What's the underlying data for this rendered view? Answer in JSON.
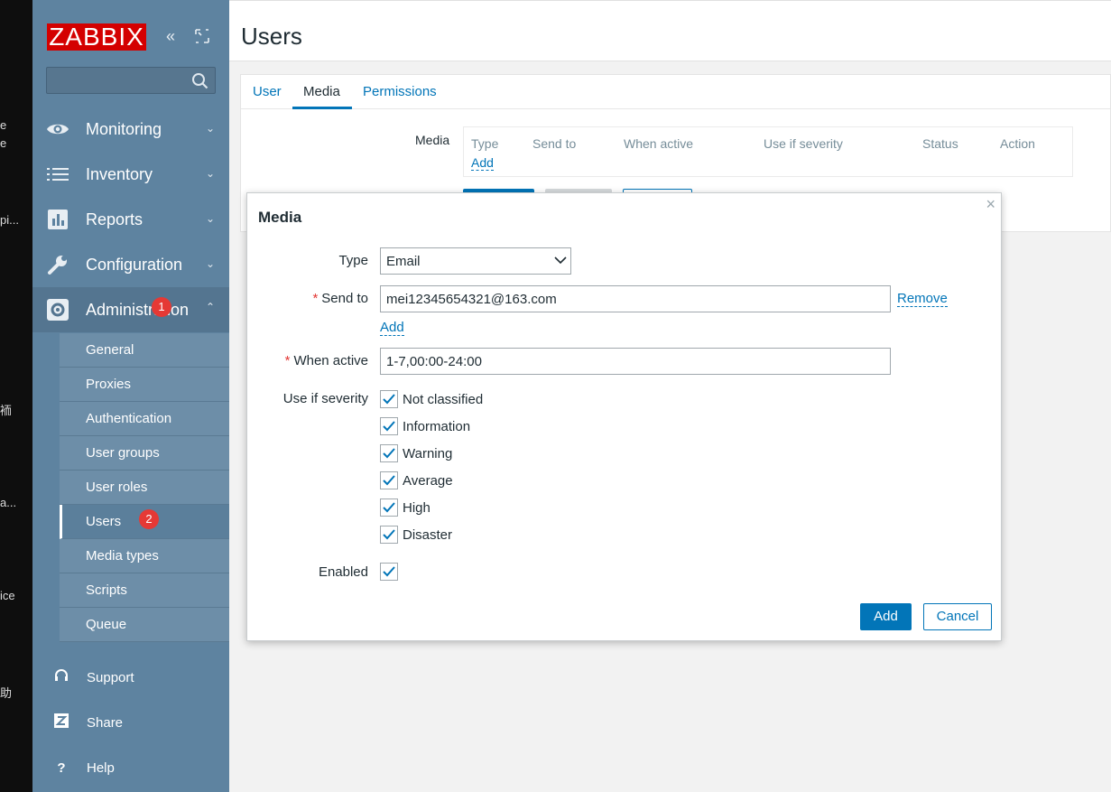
{
  "desktop": {
    "fragments": [
      "e",
      "e",
      "pi...",
      "袻",
      "a...",
      "ice",
      "助"
    ]
  },
  "sidebar": {
    "logo": "ZABBIX",
    "search": {
      "placeholder": "",
      "value": ""
    },
    "menu": [
      {
        "label": "Monitoring",
        "icon": "eye-icon",
        "expanded": false
      },
      {
        "label": "Inventory",
        "icon": "list-icon",
        "expanded": false
      },
      {
        "label": "Reports",
        "icon": "bar-chart-icon",
        "expanded": false
      },
      {
        "label": "Configuration",
        "icon": "wrench-icon",
        "expanded": false
      },
      {
        "label": "Administration",
        "icon": "gear-icon",
        "expanded": true
      }
    ],
    "submenu": [
      {
        "label": "General"
      },
      {
        "label": "Proxies"
      },
      {
        "label": "Authentication"
      },
      {
        "label": "User groups"
      },
      {
        "label": "User roles"
      },
      {
        "label": "Users",
        "active": true
      },
      {
        "label": "Media types"
      },
      {
        "label": "Scripts"
      },
      {
        "label": "Queue"
      }
    ],
    "footer": [
      {
        "label": "Support",
        "icon": "headset-icon"
      },
      {
        "label": "Share",
        "icon": "z-icon"
      },
      {
        "label": "Help",
        "icon": "question-icon"
      }
    ],
    "badges": {
      "administration": "1",
      "users": "2"
    }
  },
  "main": {
    "title": "Users",
    "tabs": [
      {
        "label": "User"
      },
      {
        "label": "Media",
        "active": true
      },
      {
        "label": "Permissions"
      }
    ],
    "media_section": {
      "label": "Media",
      "columns": [
        "Type",
        "Send to",
        "When active",
        "Use if severity",
        "Status",
        "Action"
      ],
      "add_link": "Add"
    }
  },
  "dialog": {
    "title": "Media",
    "fields": {
      "type": {
        "label": "Type",
        "value": "Email"
      },
      "send_to": {
        "label": "Send to",
        "value": "mei12345654321@163.com",
        "remove": "Remove",
        "add": "Add",
        "required": "*"
      },
      "when_active": {
        "label": "When active",
        "value": "1-7,00:00-24:00",
        "required": "*"
      },
      "severity": {
        "label": "Use if severity",
        "options": [
          {
            "label": "Not classified",
            "checked": true
          },
          {
            "label": "Information",
            "checked": true
          },
          {
            "label": "Warning",
            "checked": true
          },
          {
            "label": "Average",
            "checked": true
          },
          {
            "label": "High",
            "checked": true
          },
          {
            "label": "Disaster",
            "checked": true
          }
        ]
      },
      "enabled": {
        "label": "Enabled",
        "checked": true
      }
    },
    "buttons": {
      "add": "Add",
      "cancel": "Cancel"
    },
    "close_glyph": "×"
  },
  "colors": {
    "sidebar": "#5e83a0",
    "accent": "#0275b8",
    "logo": "#d40000",
    "badge": "#e53935"
  }
}
